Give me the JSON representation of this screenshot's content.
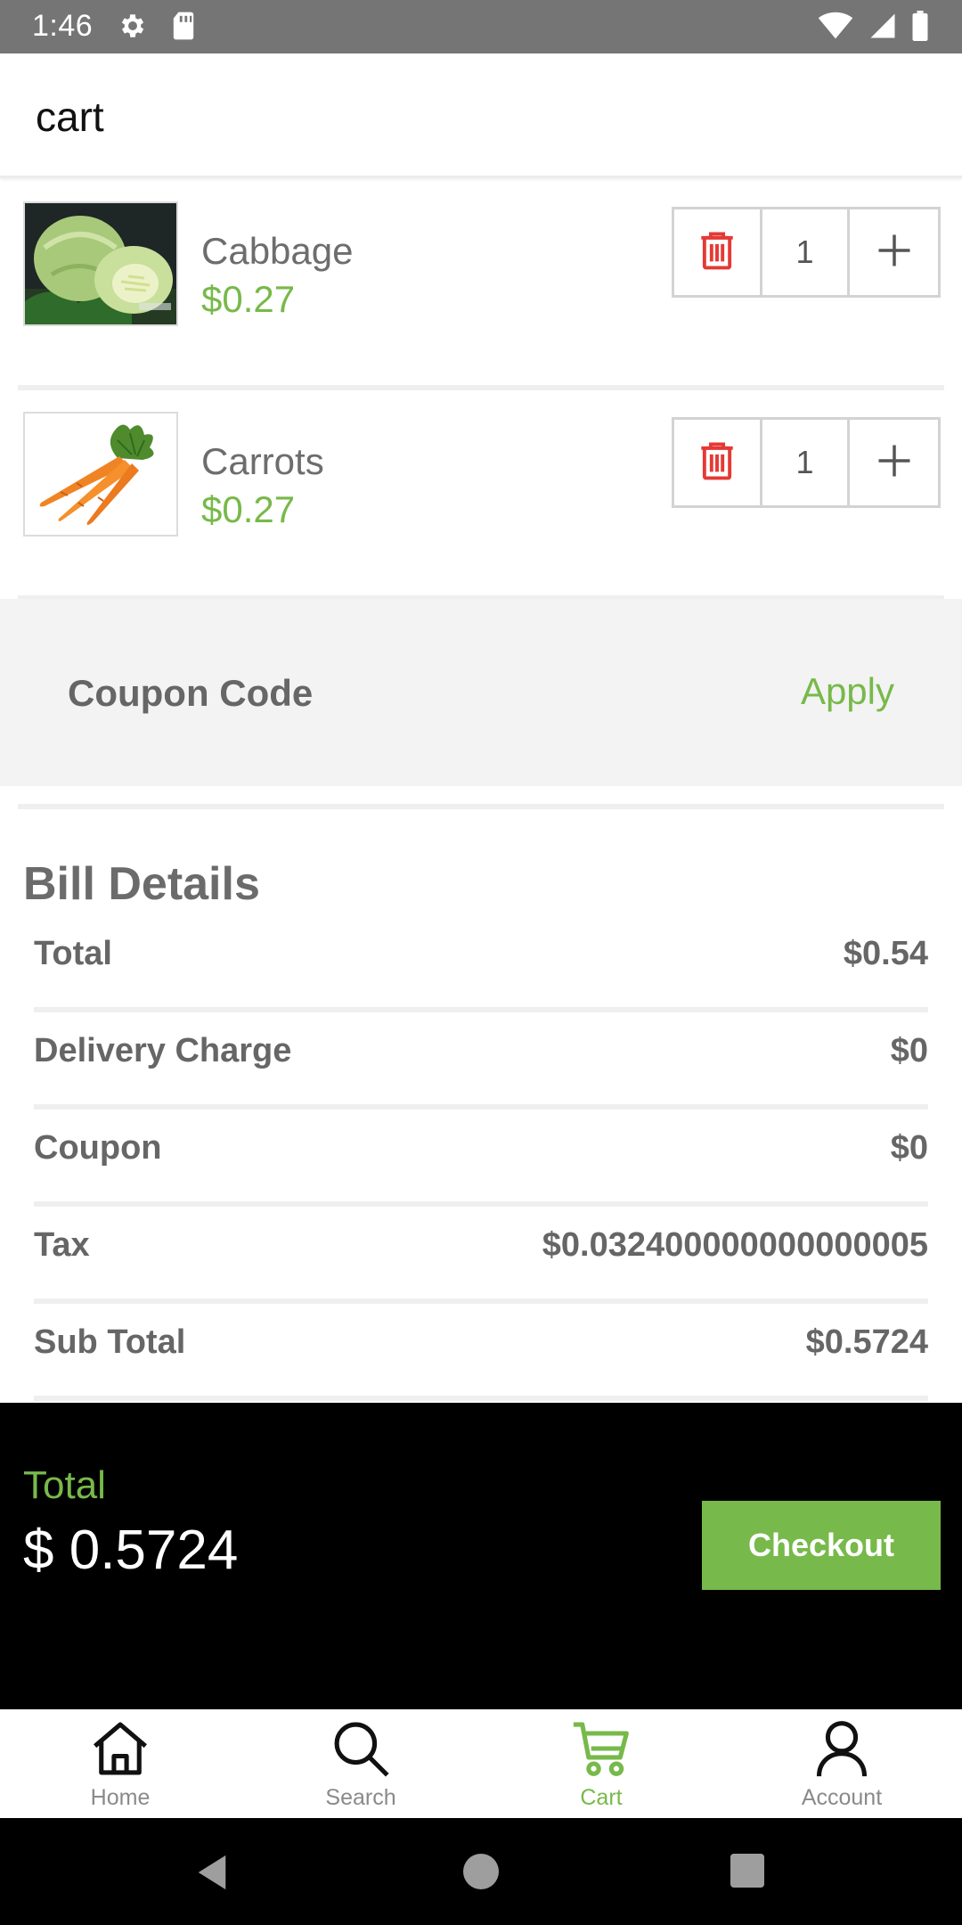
{
  "status_bar": {
    "time": "1:46"
  },
  "app_bar": {
    "title": "cart"
  },
  "cart": {
    "items": [
      {
        "name": "Cabbage",
        "price": "$0.27",
        "quantity": "1"
      },
      {
        "name": "Carrots",
        "price": "$0.27",
        "quantity": "1"
      }
    ]
  },
  "coupon": {
    "label": "Coupon Code",
    "apply": "Apply"
  },
  "bill": {
    "title": "Bill Details",
    "rows": [
      {
        "label": "Total",
        "value": "$0.54"
      },
      {
        "label": "Delivery Charge",
        "value": "$0"
      },
      {
        "label": "Coupon",
        "value": "$0"
      },
      {
        "label": "Tax",
        "value": "$0.032400000000000005"
      },
      {
        "label": "Sub Total",
        "value": "$0.5724"
      }
    ]
  },
  "footer": {
    "total_label": "Total",
    "total_amount": "$ 0.5724",
    "checkout": "Checkout"
  },
  "bottom_nav": {
    "items": [
      {
        "label": "Home",
        "icon": "home-icon"
      },
      {
        "label": "Search",
        "icon": "search-icon"
      },
      {
        "label": "Cart",
        "icon": "cart-icon",
        "active": true
      },
      {
        "label": "Account",
        "icon": "account-icon"
      }
    ]
  },
  "colors": {
    "accent": "#77b94a",
    "delete": "#e53935",
    "status_bar": "#757575"
  }
}
